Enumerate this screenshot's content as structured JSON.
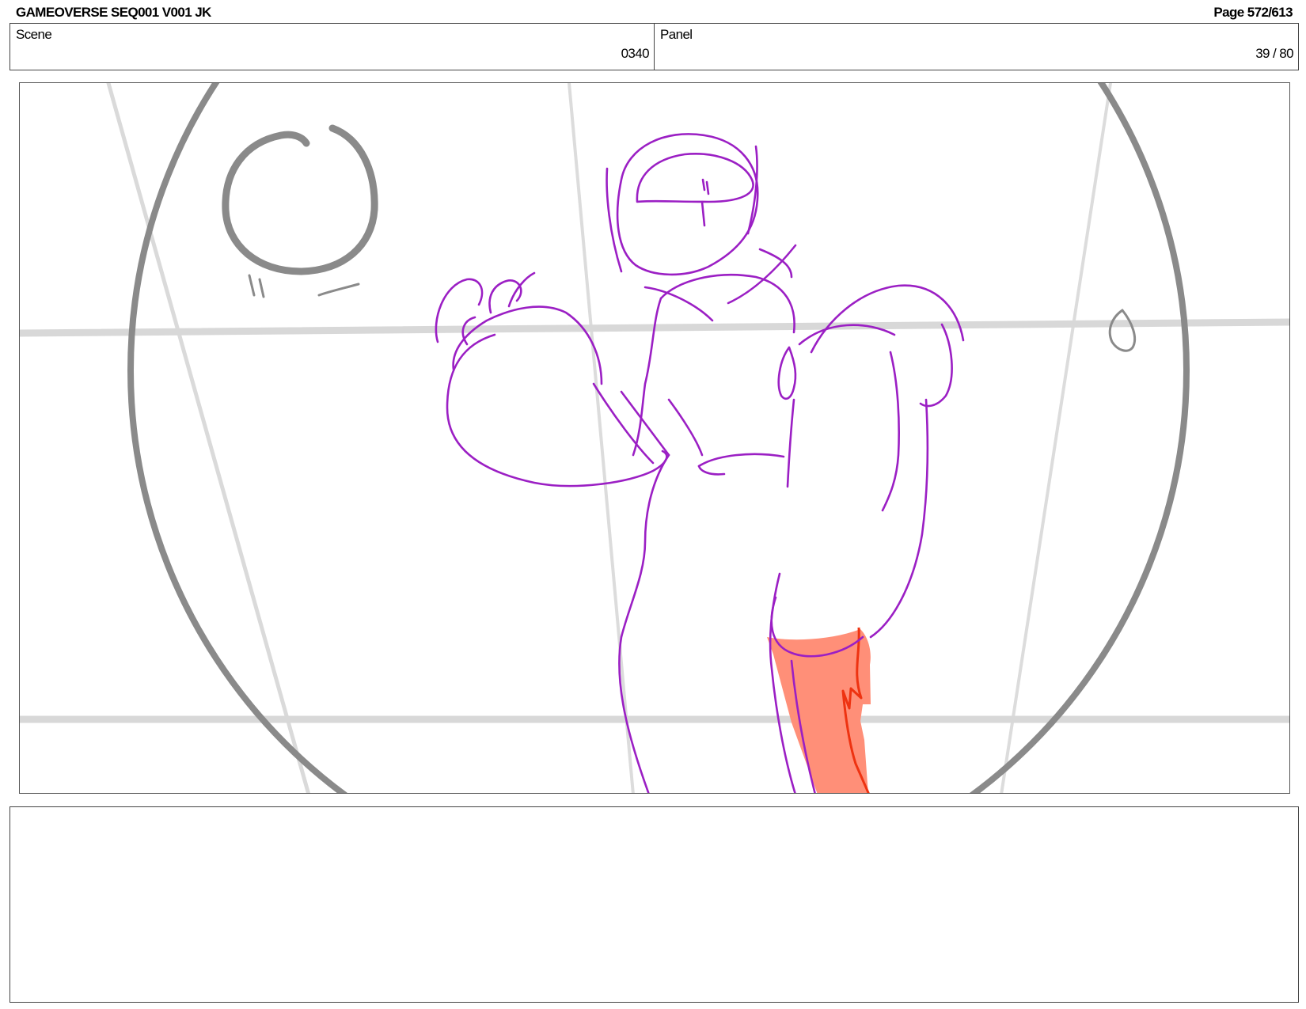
{
  "header": {
    "title": "GAMEOVERSE SEQ001 V001 JK",
    "page": "Page 572/613"
  },
  "info": {
    "scene_label": "Scene",
    "scene_value": "0340",
    "panel_label": "Panel",
    "panel_value": "39 / 80"
  },
  "panel_image": {
    "subject": "rough storyboard sketch",
    "colors": {
      "layout_gray": "#8a8a8a",
      "guide_gray": "#d8d8d8",
      "character_purple": "#9b1fc4",
      "accent_red": "#ee3311",
      "fill_salmon": "#ff8f78"
    }
  },
  "notes": {
    "text": ""
  }
}
